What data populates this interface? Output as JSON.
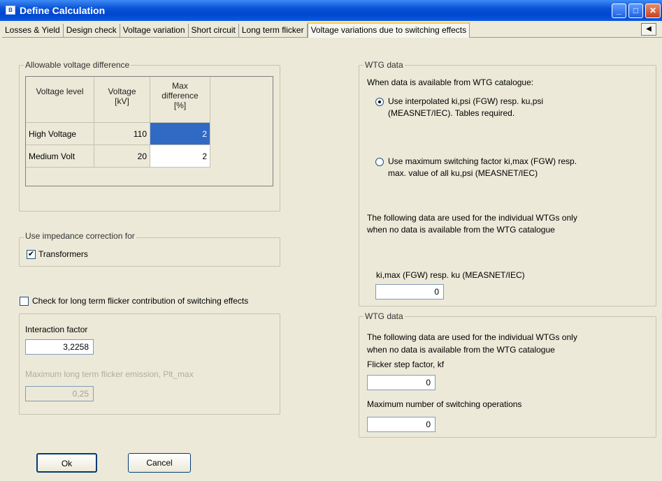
{
  "window": {
    "title": "Define Calculation",
    "app_icon_text": "B"
  },
  "tabs": [
    {
      "label": "Losses & Yield"
    },
    {
      "label": "Design check"
    },
    {
      "label": "Voltage variation"
    },
    {
      "label": "Short circuit"
    },
    {
      "label": "Long term flicker"
    },
    {
      "label": "Voltage variations due to switching effects",
      "active": true
    }
  ],
  "voltage_group": {
    "legend": "Allowable voltage difference",
    "headers": [
      "Voltage level",
      "Voltage [kV]",
      "Max difference [%]"
    ],
    "rows": [
      {
        "level": "High Voltage",
        "voltage": "110",
        "max_diff": "2"
      },
      {
        "level": "Medium Volt",
        "voltage": "20",
        "max_diff": "2"
      }
    ]
  },
  "impedance_group": {
    "legend": "Use impedance correction for",
    "transformers_label": "Transformers",
    "transformers_checked": true
  },
  "long_term_check": {
    "label": "Check for long term flicker contribution of switching effects",
    "checked": false
  },
  "interaction": {
    "factor_label": "Interaction factor",
    "factor_value": "3,2258",
    "max_emission_label": "Maximum long term flicker emission, Plt_max",
    "max_emission_value": "0,25"
  },
  "wtg_group_1": {
    "legend": "WTG data",
    "intro": "When data is available from WTG catalogue:",
    "option1_line1": "Use interpolated ki,psi (FGW) resp. ku,psi",
    "option1_line2": "(MEASNET/IEC). Tables required.",
    "option2_line1": "Use maximum switching factor ki,max (FGW) resp.",
    "option2_line2": "max. value of all ku,psi (MEASNET/IEC)",
    "note_line1": "The following data are used for the individual WTGs only",
    "note_line2": "when no data is available from the WTG catalogue",
    "ki_label": "ki,max (FGW) resp. ku (MEASNET/IEC)",
    "ki_value": "0"
  },
  "wtg_group_2": {
    "legend": "WTG data",
    "note_line1": "The following data are used for the individual WTGs only",
    "note_line2": "when no data is available from the WTG catalogue",
    "kf_label": "Flicker step factor, kf",
    "kf_value": "0",
    "max_ops_label": "Maximum number of switching operations",
    "max_ops_value": "0"
  },
  "buttons": {
    "ok": "Ok",
    "cancel": "Cancel"
  }
}
